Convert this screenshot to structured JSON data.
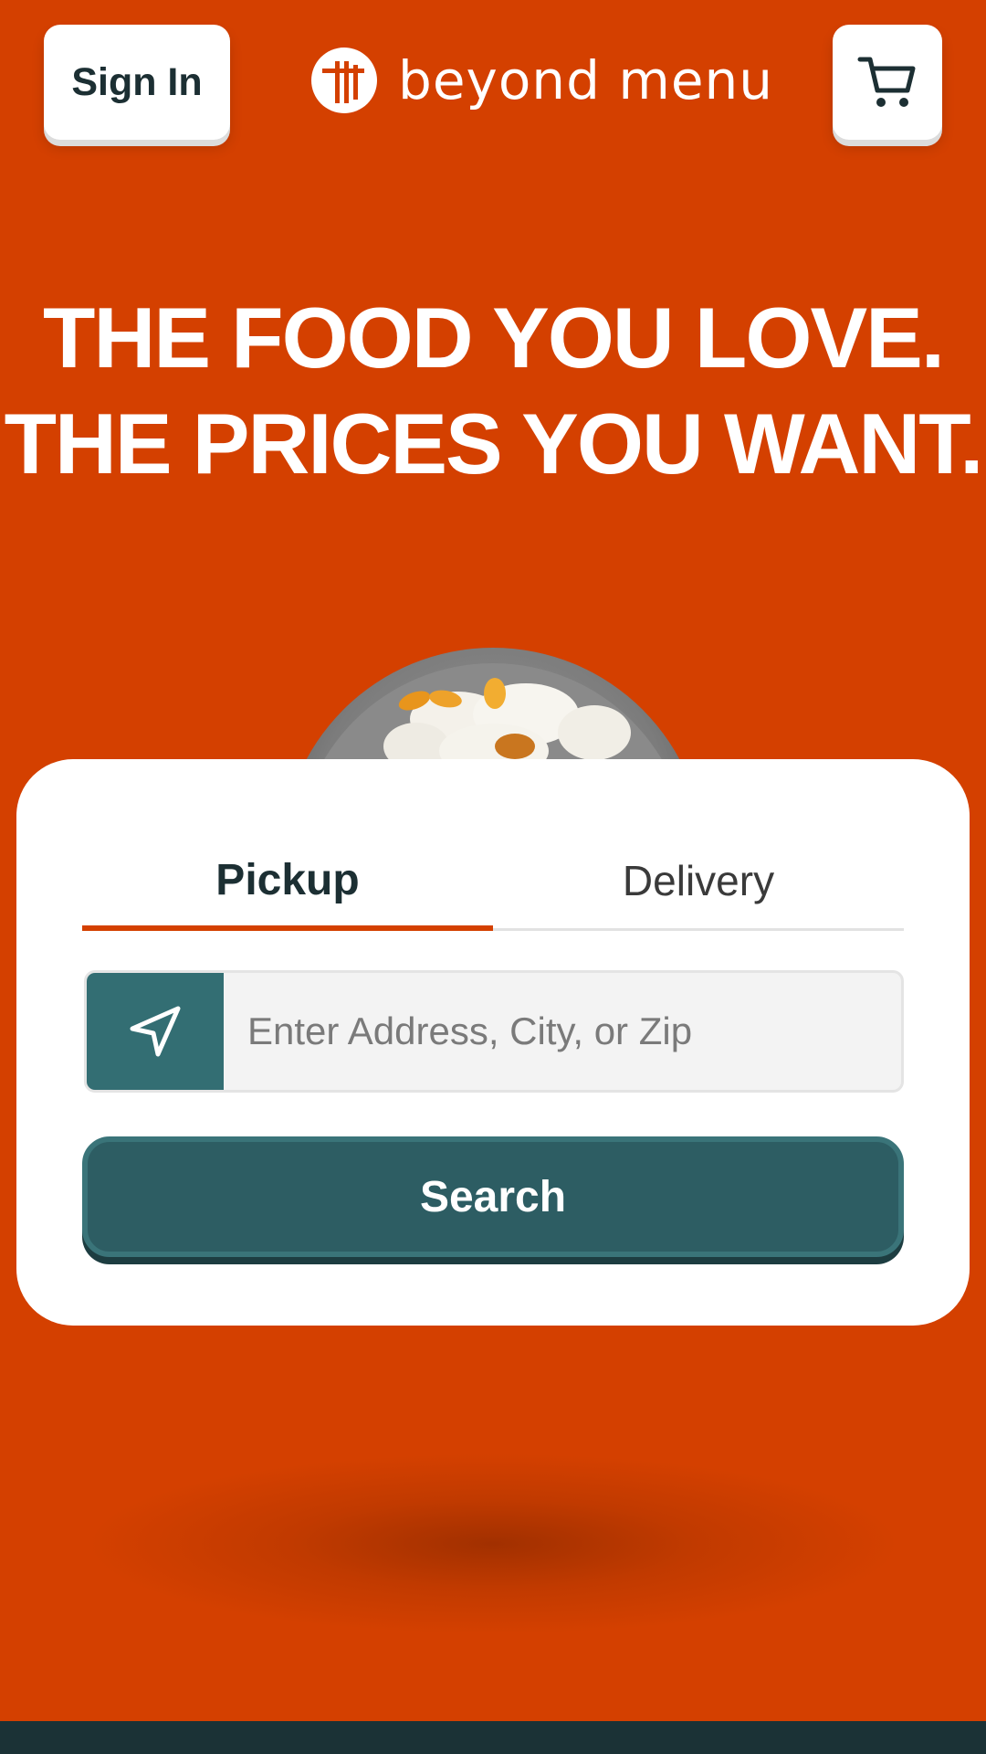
{
  "header": {
    "sign_in_label": "Sign In",
    "brand_name": "beyond menu",
    "cart_icon": "cart-icon",
    "logo_icon": "beyond-menu-logo-icon"
  },
  "hero": {
    "headline_line1": "THE FOOD YOU LOVE.",
    "headline_line2": "THE PRICES YOU WANT.",
    "image": "rice-bowl-image"
  },
  "search_card": {
    "tabs": [
      {
        "label": "Pickup",
        "selected": true
      },
      {
        "label": "Delivery",
        "selected": false
      }
    ],
    "location_icon": "location-arrow-icon",
    "address_placeholder": "Enter Address, City, or Zip",
    "address_value": "",
    "search_label": "Search"
  },
  "colors": {
    "background": "#d44000",
    "accent_teal": "#2d5d63",
    "text_dark": "#1c2f33",
    "white": "#ffffff"
  }
}
